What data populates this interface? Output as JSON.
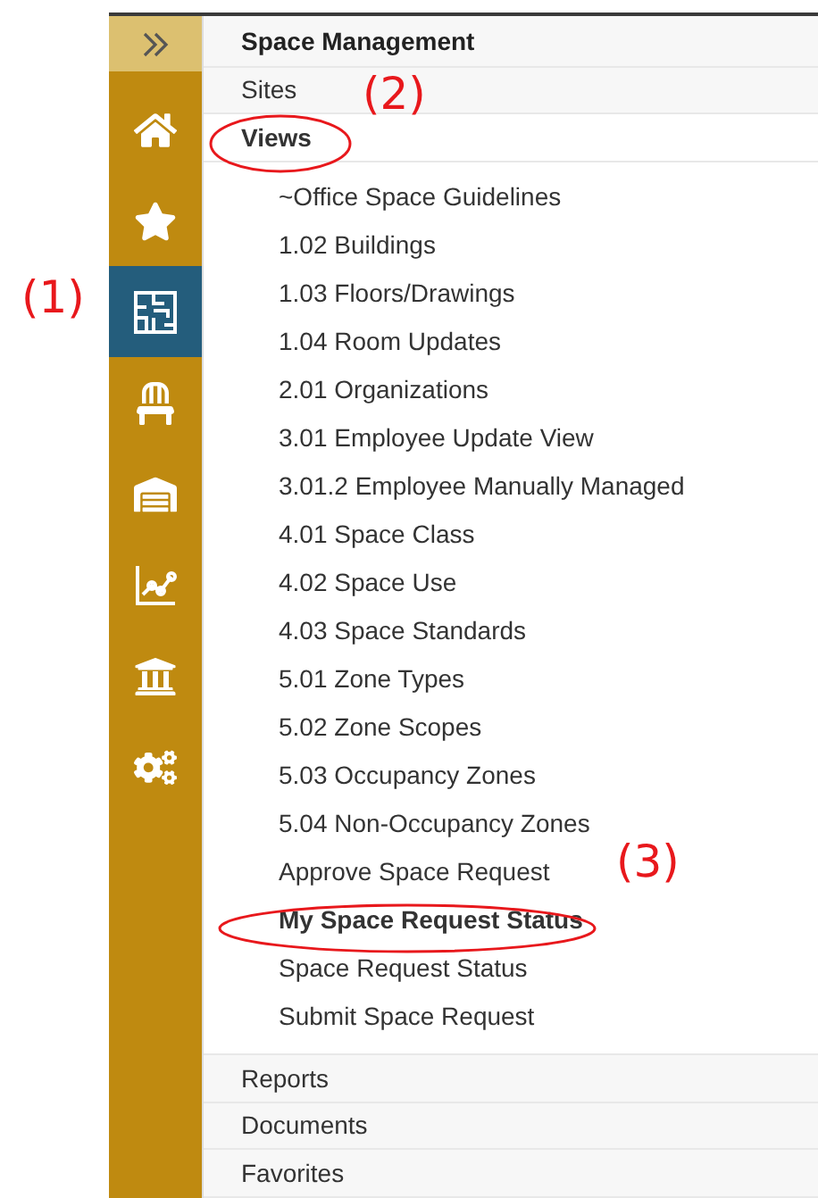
{
  "sidebar": {
    "items": [
      {
        "selected": false
      },
      {
        "selected": false
      },
      {
        "selected": true
      },
      {
        "selected": false
      },
      {
        "selected": false
      },
      {
        "selected": false
      },
      {
        "selected": false
      },
      {
        "selected": false
      }
    ]
  },
  "menu": {
    "title": "Space Management",
    "sections": [
      {
        "label": "Sites",
        "selected": false,
        "expanded": false
      },
      {
        "label": "Views",
        "selected": true,
        "expanded": true,
        "children": [
          {
            "label": "~Office Space Guidelines",
            "selected": false
          },
          {
            "label": "1.02 Buildings",
            "selected": false
          },
          {
            "label": "1.03 Floors/Drawings",
            "selected": false
          },
          {
            "label": "1.04 Room Updates",
            "selected": false
          },
          {
            "label": "2.01 Organizations",
            "selected": false
          },
          {
            "label": "3.01 Employee Update View",
            "selected": false
          },
          {
            "label": "3.01.2 Employee Manually Managed",
            "selected": false
          },
          {
            "label": "4.01 Space Class",
            "selected": false
          },
          {
            "label": "4.02 Space Use",
            "selected": false
          },
          {
            "label": "4.03 Space Standards",
            "selected": false
          },
          {
            "label": "5.01 Zone Types",
            "selected": false
          },
          {
            "label": "5.02 Zone Scopes",
            "selected": false
          },
          {
            "label": "5.03 Occupancy Zones",
            "selected": false
          },
          {
            "label": "5.04 Non-Occupancy Zones",
            "selected": false
          },
          {
            "label": "Approve Space Request",
            "selected": false
          },
          {
            "label": "My Space Request Status",
            "selected": true
          },
          {
            "label": "Space Request Status",
            "selected": false
          },
          {
            "label": "Submit Space Request",
            "selected": false
          }
        ]
      },
      {
        "label": "Reports",
        "selected": false,
        "expanded": false
      },
      {
        "label": "Documents",
        "selected": false,
        "expanded": false
      },
      {
        "label": "Favorites",
        "selected": false,
        "expanded": false
      }
    ]
  },
  "annotations": [
    {
      "label": "(1)"
    },
    {
      "label": "(2)"
    },
    {
      "label": "(3)"
    }
  ]
}
